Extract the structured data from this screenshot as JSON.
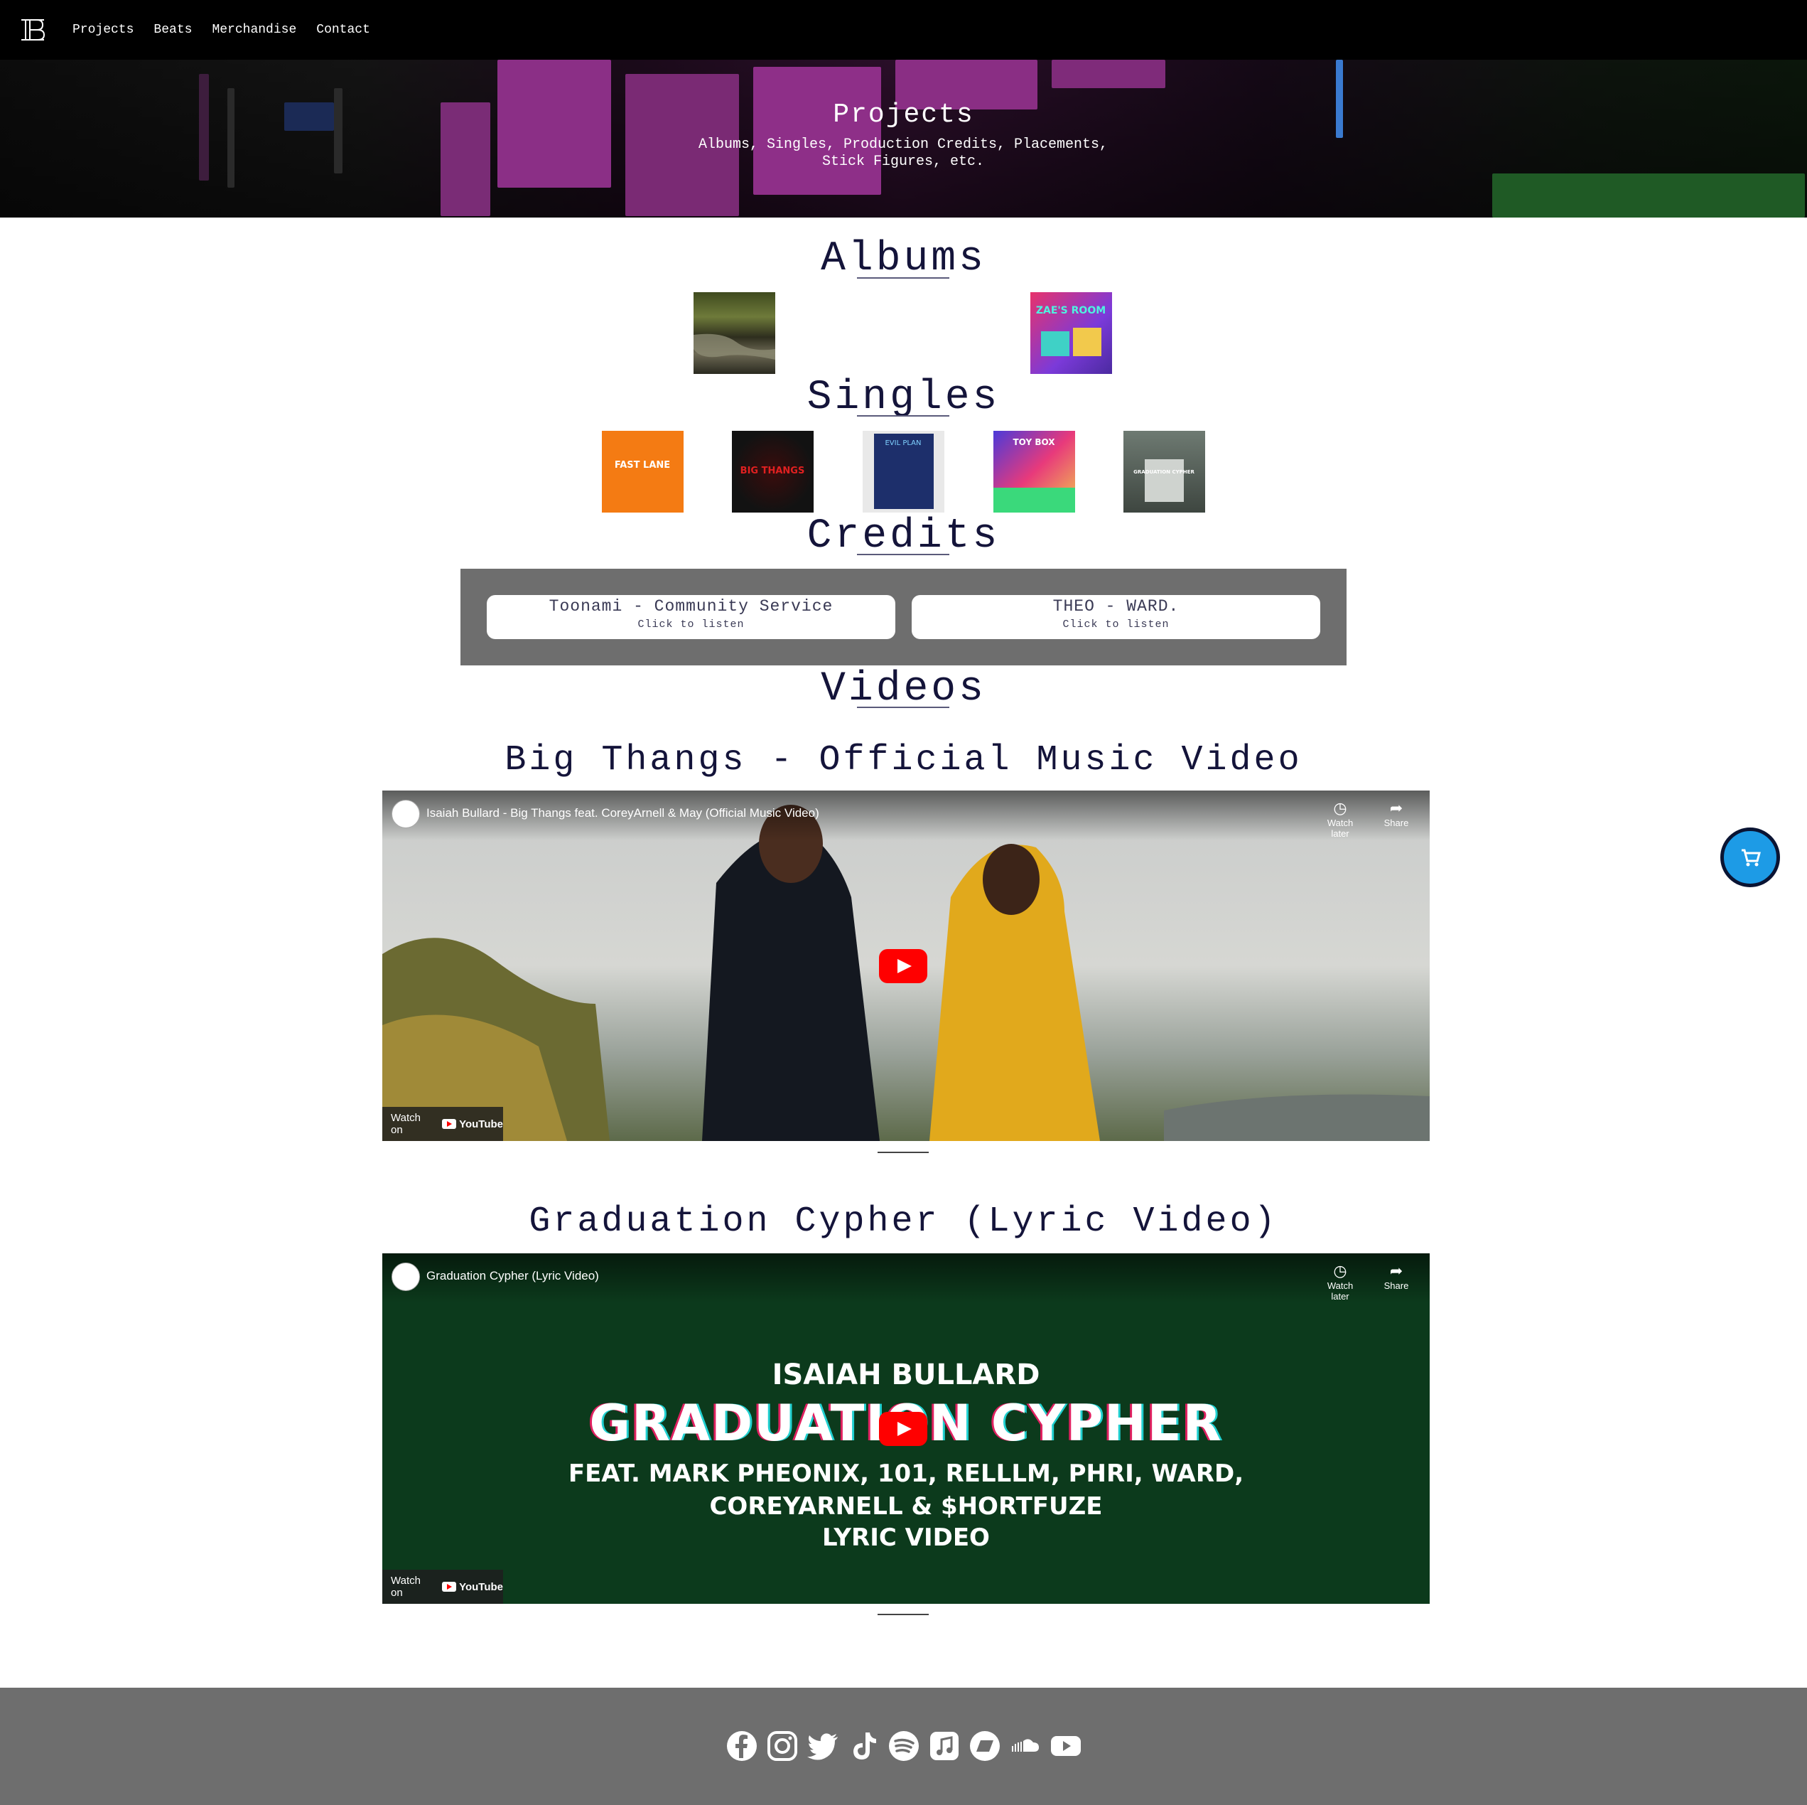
{
  "nav": {
    "logo": "IB",
    "links": [
      "Projects",
      "Beats",
      "Merchandise",
      "Contact"
    ]
  },
  "hero": {
    "title": "Projects",
    "subtitle": "Albums, Singles, Production Credits, Placements, Stick Figures, etc."
  },
  "sections": {
    "albums": "Albums",
    "singles": "Singles",
    "credits": "Credits",
    "videos": "Videos"
  },
  "albums": [
    {
      "name": "river-album-cover"
    },
    {
      "name": "zae-s-room-album-cover",
      "text": "ZAE'S ROOM"
    }
  ],
  "singles": [
    {
      "name": "fast-lane-single-cover",
      "text": "FAST LANE"
    },
    {
      "name": "big-thangs-single-cover",
      "text": "BIG THANGS"
    },
    {
      "name": "evil-plan-single-cover",
      "text": "EVIL PLAN"
    },
    {
      "name": "toy-box-single-cover",
      "text": "TOY BOX"
    },
    {
      "name": "graduation-cypher-single-cover",
      "text": "GRADUATION CYPHER"
    }
  ],
  "credits": [
    {
      "title": "Toonami - Community Service",
      "sub": "Click to listen"
    },
    {
      "title": "THEO - WARD.",
      "sub": "Click to listen"
    }
  ],
  "videos": [
    {
      "heading": "Big Thangs - Official Music Video",
      "embed_title": "Isaiah Bullard - Big Thangs feat. CoreyArnell & May (Official Music Video)",
      "watch_later": "Watch later",
      "share": "Share",
      "watch_on": "Watch on",
      "youtube": "YouTube"
    },
    {
      "heading": "Graduation Cypher (Lyric Video)",
      "embed_title": "Graduation Cypher (Lyric Video)",
      "watch_later": "Watch later",
      "share": "Share",
      "watch_on": "Watch on",
      "youtube": "YouTube",
      "poster_lines": [
        "ISAIAH BULLARD",
        "GRADUATION CYPHER",
        "FEAT. MARK PHEONIX, 101, RELLLM, PHRI, WARD,",
        "COREYARNELL & $HORTFUZE",
        "LYRIC VIDEO"
      ]
    }
  ],
  "footer": {
    "social_icons": [
      "facebook-icon",
      "instagram-icon",
      "twitter-icon",
      "tiktok-icon",
      "spotify-icon",
      "apple-music-icon",
      "bandcamp-icon",
      "soundcloud-icon",
      "youtube-icon"
    ]
  },
  "colors": {
    "heading": "#14143a",
    "cart": "#1d9be6",
    "footer": "#6e6e6e",
    "credits_box": "#6e6e6e"
  }
}
